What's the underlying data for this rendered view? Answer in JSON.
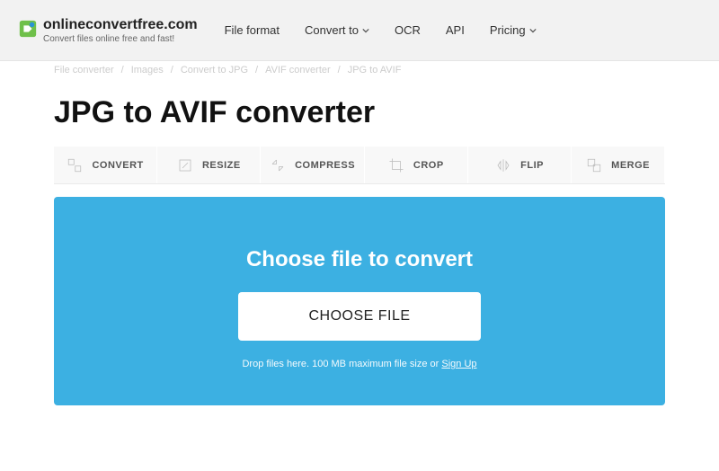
{
  "header": {
    "logo_title": "onlineconvertfree.com",
    "logo_sub": "Convert files online free and fast!",
    "nav": {
      "file_format": "File format",
      "convert_to": "Convert to",
      "ocr": "OCR",
      "api": "API",
      "pricing": "Pricing"
    }
  },
  "breadcrumb": {
    "b0": "File converter",
    "b1": "Images",
    "b2": "Convert to JPG",
    "b3": "AVIF converter",
    "b4": "JPG to AVIF"
  },
  "page_title": "JPG to AVIF converter",
  "tools": {
    "convert": "CONVERT",
    "resize": "RESIZE",
    "compress": "COMPRESS",
    "crop": "CROP",
    "flip": "FLIP",
    "merge": "MERGE"
  },
  "upload": {
    "heading": "Choose file to convert",
    "button": "CHOOSE FILE",
    "drop_prefix": "Drop files here. 100 MB maximum file size or ",
    "signup": "Sign Up"
  }
}
